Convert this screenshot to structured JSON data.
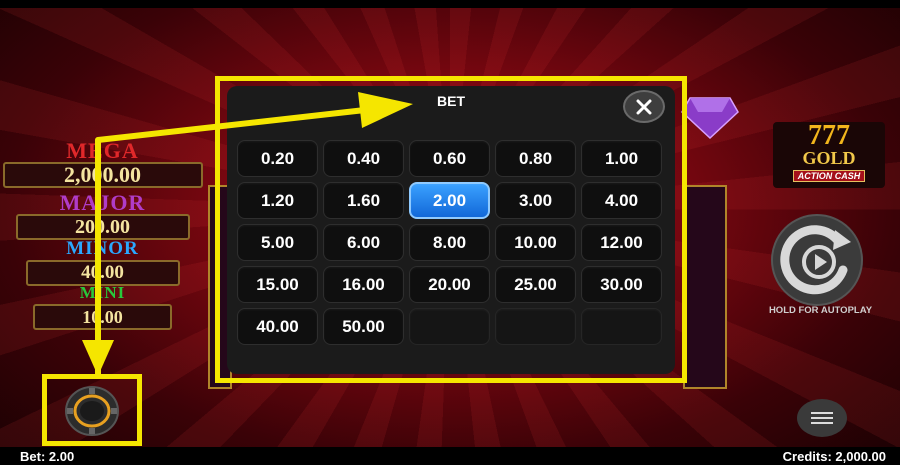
{
  "jackpots": [
    {
      "label": "MEGA",
      "value": "2,000.00",
      "label_color": "#e0282a"
    },
    {
      "label": "MAJOR",
      "value": "200.00",
      "label_color": "#b03cc8"
    },
    {
      "label": "MINOR",
      "value": "40.00",
      "label_color": "#2aa8ff"
    },
    {
      "label": "MINI",
      "value": "10.00",
      "label_color": "#28c83c"
    }
  ],
  "logo": {
    "numbers": "777",
    "word": "GOLD",
    "subtitle": "ACTION CASH"
  },
  "autoplay_label": "HOLD FOR AUTOPLAY",
  "status": {
    "bet": "Bet: 2.00",
    "credits": "Credits: 2,000.00"
  },
  "bet_modal": {
    "title": "BET",
    "selected": "2.00",
    "options": [
      "0.20",
      "0.40",
      "0.60",
      "0.80",
      "1.00",
      "1.20",
      "1.60",
      "2.00",
      "3.00",
      "4.00",
      "5.00",
      "6.00",
      "8.00",
      "10.00",
      "12.00",
      "15.00",
      "16.00",
      "20.00",
      "25.00",
      "30.00",
      "40.00",
      "50.00"
    ],
    "empty_slots": 3
  },
  "colors": {
    "highlight": "#f5e600",
    "selected": "#1e80ee",
    "background": "#7a0710"
  },
  "icons": [
    "close-icon",
    "spin-icon",
    "menu-icon",
    "chip-icon",
    "arrow-icon"
  ]
}
